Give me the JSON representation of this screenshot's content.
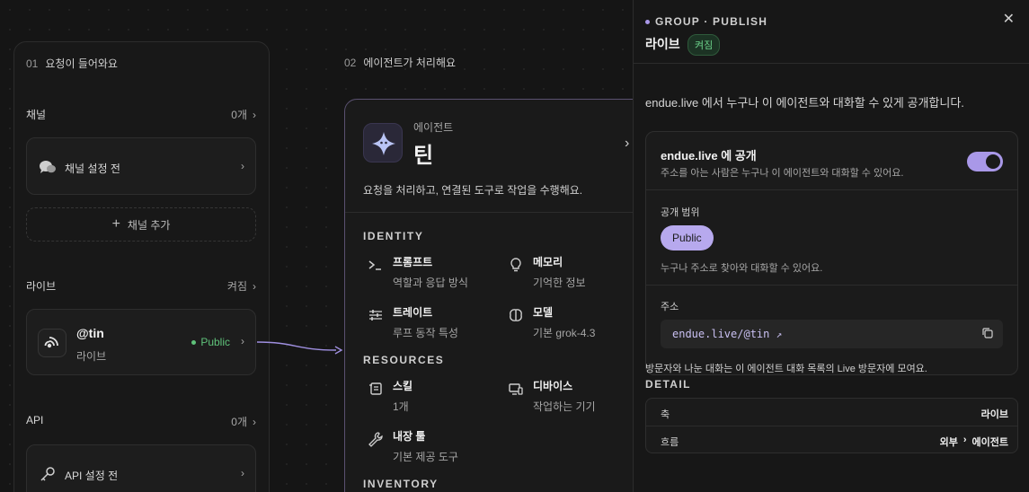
{
  "column1": {
    "number": "01",
    "title": "요청이 들어와요",
    "channel": {
      "label": "채널",
      "count": "0개",
      "card_label": "채널 설정 전",
      "add_label": "채널 추가"
    },
    "live": {
      "label": "라이브",
      "status": "켜짐",
      "handle": "@tin",
      "sub": "라이브",
      "visibility": "Public"
    },
    "api": {
      "label": "API",
      "count": "0개",
      "card_label": "API 설정 전"
    }
  },
  "column2": {
    "number": "02",
    "title": "에이전트가 처리해요",
    "agent": {
      "kind": "에이전트",
      "name": "틴",
      "description": "요청을 처리하고, 연결된 도구로 작업을 수행해요."
    },
    "identity": {
      "title": "IDENTITY",
      "items": [
        {
          "title": "프롬프트",
          "sub": "역할과 응답 방식",
          "icon": "terminal-icon"
        },
        {
          "title": "메모리",
          "sub": "기억한 정보",
          "icon": "lightbulb-icon"
        },
        {
          "title": "트레이트",
          "sub": "루프 동작 특성",
          "icon": "sliders-icon"
        },
        {
          "title": "모델",
          "sub": "기본 grok-4.3",
          "icon": "brain-icon"
        }
      ]
    },
    "resources": {
      "title": "RESOURCES",
      "items": [
        {
          "title": "스킬",
          "sub": "1개",
          "icon": "scroll-icon"
        },
        {
          "title": "디바이스",
          "sub": "작업하는 기기",
          "icon": "devices-icon"
        },
        {
          "title": "내장 툴",
          "sub": "기본 제공 도구",
          "icon": "wrench-icon"
        }
      ]
    },
    "inventory": {
      "title": "INVENTORY"
    }
  },
  "panel": {
    "eyebrow": "GROUP · PUBLISH",
    "title": "라이브",
    "status_badge": "켜짐",
    "intro": "endue.live 에서 누구나 이 에이전트와 대화할 수 있게 공개합니다.",
    "publish": {
      "title": "endue.live 에 공개",
      "description": "주소를 아는 사람은 누구나 이 에이전트와 대화할 수 있어요.",
      "enabled": true
    },
    "scope": {
      "label": "공개 범위",
      "selected": "Public",
      "description": "누구나 주소로 찾아와 대화할 수 있어요."
    },
    "address": {
      "label": "주소",
      "url": "endue.live/@tin",
      "note": "방문자와 나눈 대화는 이 에이전트 대화 목록의 Live 방문자에 모여요."
    },
    "detail": {
      "title": "DETAIL",
      "rows": [
        {
          "key": "축",
          "value": "라이브"
        },
        {
          "key": "흐름",
          "value_from": "외부",
          "value_arrow": "›",
          "value_to": "에이전트"
        }
      ]
    }
  },
  "colors": {
    "accent": "#a998e8",
    "live_green": "#4caf6a",
    "background": "#151515"
  }
}
